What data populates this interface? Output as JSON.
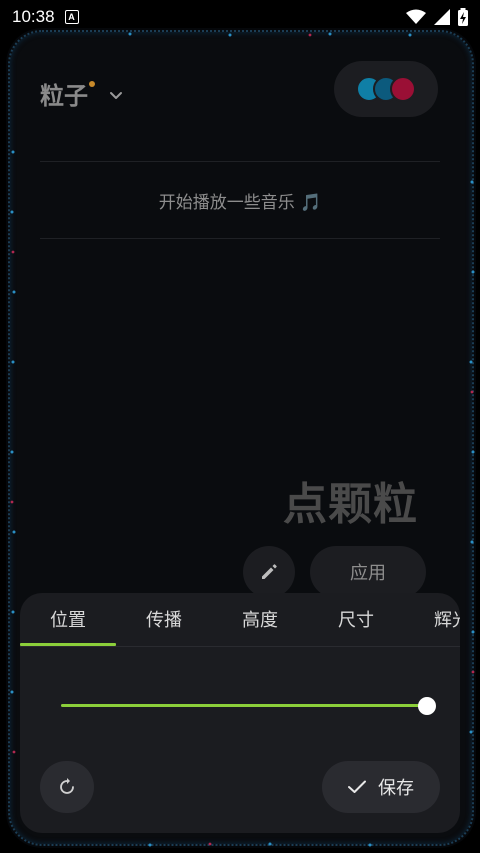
{
  "status": {
    "time": "10:38",
    "badge": "A"
  },
  "header": {
    "title": "粒子",
    "dot_color": "#c88a2a"
  },
  "palette": {
    "colors": [
      "#0f7fa6",
      "#0c5a7d",
      "#9a0f35"
    ]
  },
  "music_hint": "开始播放一些音乐 🎵",
  "preview_text": "点颗粒",
  "actions": {
    "apply_label": "应用"
  },
  "sheet": {
    "tabs": [
      {
        "label": "位置"
      },
      {
        "label": "传播"
      },
      {
        "label": "高度"
      },
      {
        "label": "尺寸"
      },
      {
        "label": "辉光"
      }
    ],
    "active_tab": 0,
    "slider_value": 1.0,
    "accent": "#8ccf3a",
    "save_label": "保存"
  },
  "icons": [
    "wifi-icon",
    "signal-icon",
    "battery-icon",
    "chevron-down-icon",
    "pencil-icon",
    "reset-icon",
    "check-icon"
  ]
}
